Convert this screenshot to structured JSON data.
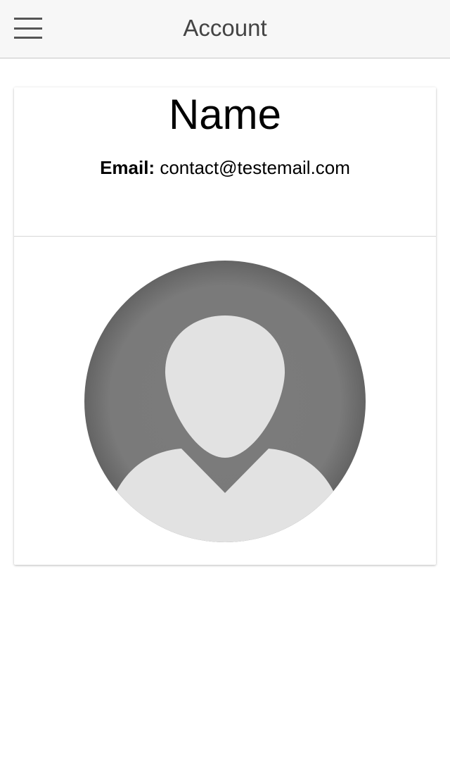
{
  "header": {
    "title": "Account",
    "menu_icon": "hamburger-menu-icon"
  },
  "profile": {
    "name": "Name",
    "email_label": "Email:",
    "email": "contact@testemail.com",
    "avatar_icon": "default-user-avatar-icon"
  },
  "colors": {
    "appbar_bg": "#f7f7f7",
    "avatar_bg": "#7a7a7a",
    "avatar_figure": "#e2e2e2"
  }
}
